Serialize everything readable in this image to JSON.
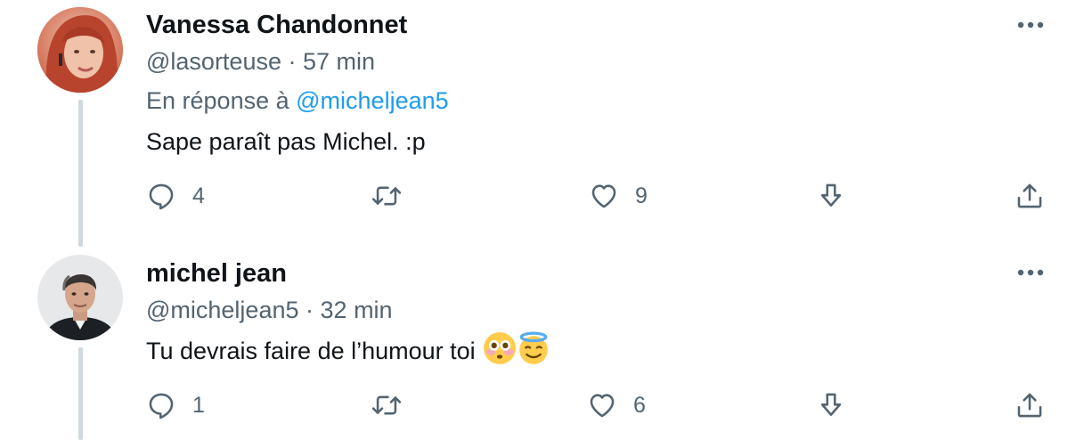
{
  "tweets": [
    {
      "name": "Vanessa Chandonnet",
      "handle": "@lasorteuse",
      "separator": "·",
      "time": "57 min",
      "reply_prefix": "En réponse à",
      "reply_handle": "@micheljean5",
      "text": "Sape paraît pas Michel. :p",
      "reply_count": "4",
      "retweet_count": "",
      "like_count": "9"
    },
    {
      "name": "michel jean",
      "handle": "@micheljean5",
      "separator": "·",
      "time": "32 min",
      "text": "Tu devrais faire de l’humour toi",
      "emojis": [
        "flushed-face",
        "smiling-face-with-halo"
      ],
      "reply_count": "1",
      "retweet_count": "",
      "like_count": "6"
    }
  ],
  "icons": {
    "reply": "comment-bubble-icon",
    "retweet": "retweet-icon",
    "like": "heart-icon",
    "download": "download-arrow-icon",
    "share": "share-upload-icon",
    "more": "more-dots-icon"
  },
  "colors": {
    "text": "#0f1419",
    "secondary": "#536471",
    "link": "#1d9bf0",
    "thread_line": "#cfd9de"
  }
}
